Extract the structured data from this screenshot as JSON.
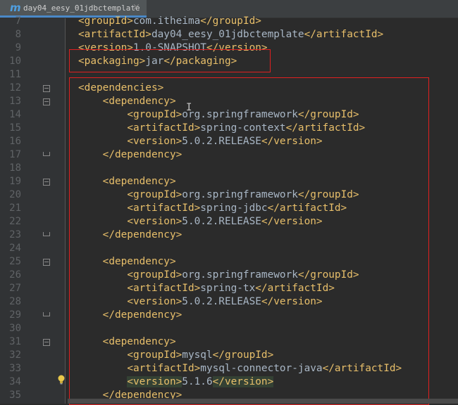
{
  "tab": {
    "icon": "maven-m-icon",
    "label": "m",
    "filename": "day04_eesy_01jdbctemplate",
    "close": "×"
  },
  "lines": [
    {
      "n": "7",
      "parts": [
        [
          "tag",
          "<groupId>"
        ],
        [
          "txt",
          "com.itheima"
        ],
        [
          "tag",
          "</groupId>"
        ]
      ]
    },
    {
      "n": "8",
      "parts": [
        [
          "tag",
          "<artifactId>"
        ],
        [
          "txt",
          "day04_eesy_01jdbctemplate"
        ],
        [
          "tag",
          "</artifactId>"
        ]
      ]
    },
    {
      "n": "9",
      "parts": [
        [
          "tag",
          "<version>"
        ],
        [
          "txt",
          "1.0-SNAPSHOT"
        ],
        [
          "tag",
          "</version>"
        ]
      ]
    },
    {
      "n": "10",
      "parts": [
        [
          "tag",
          "<packaging>"
        ],
        [
          "txt",
          "jar"
        ],
        [
          "tag",
          "</packaging>"
        ]
      ]
    },
    {
      "n": "11",
      "parts": []
    },
    {
      "n": "12",
      "parts": [
        [
          "tag",
          "<dependencies>"
        ]
      ]
    },
    {
      "n": "13",
      "parts": [
        [
          "txt",
          "    "
        ],
        [
          "tag",
          "<dependency>"
        ]
      ]
    },
    {
      "n": "14",
      "parts": [
        [
          "txt",
          "        "
        ],
        [
          "tag",
          "<groupId>"
        ],
        [
          "txt",
          "org.springframework"
        ],
        [
          "tag",
          "</groupId>"
        ]
      ]
    },
    {
      "n": "15",
      "parts": [
        [
          "txt",
          "        "
        ],
        [
          "tag",
          "<artifactId>"
        ],
        [
          "txt",
          "spring-context"
        ],
        [
          "tag",
          "</artifactId>"
        ]
      ]
    },
    {
      "n": "16",
      "parts": [
        [
          "txt",
          "        "
        ],
        [
          "tag",
          "<version>"
        ],
        [
          "txt",
          "5.0.2.RELEASE"
        ],
        [
          "tag",
          "</version>"
        ]
      ]
    },
    {
      "n": "17",
      "parts": [
        [
          "txt",
          "    "
        ],
        [
          "tag",
          "</dependency>"
        ]
      ]
    },
    {
      "n": "18",
      "parts": []
    },
    {
      "n": "19",
      "parts": [
        [
          "txt",
          "    "
        ],
        [
          "tag",
          "<dependency>"
        ]
      ]
    },
    {
      "n": "20",
      "parts": [
        [
          "txt",
          "        "
        ],
        [
          "tag",
          "<groupId>"
        ],
        [
          "txt",
          "org.springframework"
        ],
        [
          "tag",
          "</groupId>"
        ]
      ]
    },
    {
      "n": "21",
      "parts": [
        [
          "txt",
          "        "
        ],
        [
          "tag",
          "<artifactId>"
        ],
        [
          "txt",
          "spring-jdbc"
        ],
        [
          "tag",
          "</artifactId>"
        ]
      ]
    },
    {
      "n": "22",
      "parts": [
        [
          "txt",
          "        "
        ],
        [
          "tag",
          "<version>"
        ],
        [
          "txt",
          "5.0.2.RELEASE"
        ],
        [
          "tag",
          "</version>"
        ]
      ]
    },
    {
      "n": "23",
      "parts": [
        [
          "txt",
          "    "
        ],
        [
          "tag",
          "</dependency>"
        ]
      ]
    },
    {
      "n": "24",
      "parts": []
    },
    {
      "n": "25",
      "parts": [
        [
          "txt",
          "    "
        ],
        [
          "tag",
          "<dependency>"
        ]
      ]
    },
    {
      "n": "26",
      "parts": [
        [
          "txt",
          "        "
        ],
        [
          "tag",
          "<groupId>"
        ],
        [
          "txt",
          "org.springframework"
        ],
        [
          "tag",
          "</groupId>"
        ]
      ]
    },
    {
      "n": "27",
      "parts": [
        [
          "txt",
          "        "
        ],
        [
          "tag",
          "<artifactId>"
        ],
        [
          "txt",
          "spring-tx"
        ],
        [
          "tag",
          "</artifactId>"
        ]
      ]
    },
    {
      "n": "28",
      "parts": [
        [
          "txt",
          "        "
        ],
        [
          "tag",
          "<version>"
        ],
        [
          "txt",
          "5.0.2.RELEASE"
        ],
        [
          "tag",
          "</version>"
        ]
      ]
    },
    {
      "n": "29",
      "parts": [
        [
          "txt",
          "    "
        ],
        [
          "tag",
          "</dependency>"
        ]
      ]
    },
    {
      "n": "30",
      "parts": []
    },
    {
      "n": "31",
      "parts": [
        [
          "txt",
          "    "
        ],
        [
          "tag",
          "<dependency>"
        ]
      ]
    },
    {
      "n": "32",
      "parts": [
        [
          "txt",
          "        "
        ],
        [
          "tag",
          "<groupId>"
        ],
        [
          "txt",
          "mysql"
        ],
        [
          "tag",
          "</groupId>"
        ]
      ]
    },
    {
      "n": "33",
      "parts": [
        [
          "txt",
          "        "
        ],
        [
          "tag",
          "<artifactId>"
        ],
        [
          "txt",
          "mysql-connector-java"
        ],
        [
          "tag",
          "</artifactId>"
        ]
      ]
    },
    {
      "n": "34",
      "parts": [
        [
          "txt",
          "        "
        ],
        [
          "hl",
          "<version>"
        ],
        [
          "txt",
          "5.1.6"
        ],
        [
          "hl",
          "</version>"
        ]
      ]
    },
    {
      "n": "35",
      "parts": [
        [
          "txt",
          "    "
        ],
        [
          "tag",
          "</dependency>"
        ]
      ]
    }
  ],
  "fold_open_lines": [
    "12",
    "13",
    "19",
    "25",
    "31"
  ],
  "fold_close_lines": [
    "17",
    "23",
    "29"
  ],
  "annotations": {
    "highlight_boxes": [
      "packaging",
      "dependencies"
    ],
    "color": "#e02020"
  }
}
